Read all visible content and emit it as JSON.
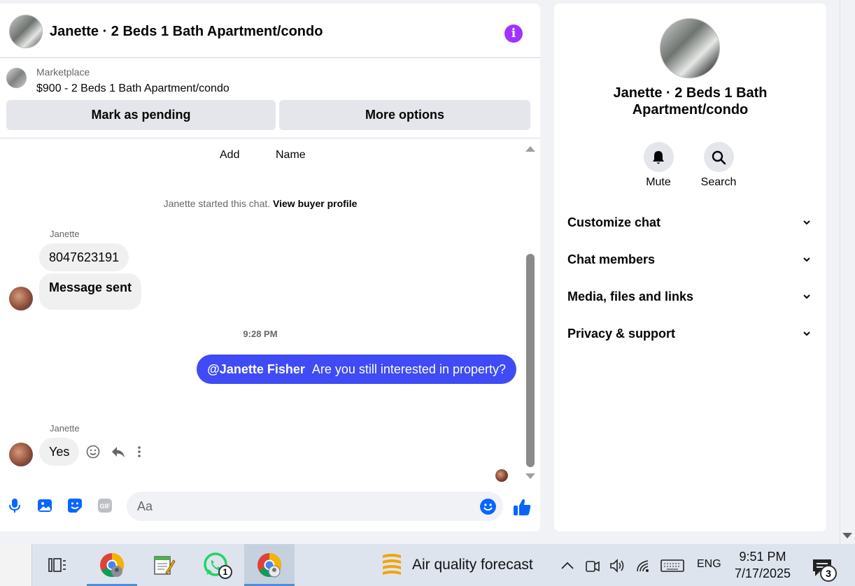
{
  "chat": {
    "title": "Janette · 2 Beds 1 Bath Apartment/condo",
    "marketplace_label": "Marketplace",
    "listing": "$900 - 2 Beds 1 Bath Apartment/condo",
    "mark_pending_label": "Mark as pending",
    "more_options_label": "More options",
    "add_label": "Add",
    "name_label": "Name",
    "started_text": "Janette started this chat.",
    "view_profile_label": "View buyer profile",
    "messages_in_1": {
      "sender": "Janette",
      "bubble1": "8047623191",
      "bubble2": "Message sent"
    },
    "time": "9:28 PM",
    "outgoing": {
      "mention": "@Janette Fisher",
      "text": "Are you still interested in property?"
    },
    "messages_in_2": {
      "sender": "Janette",
      "bubble": "Yes"
    },
    "composer_placeholder": "Aa",
    "accent": "#0866ff",
    "outgoing_bubble_color": "#3f4bf5"
  },
  "info": {
    "name": "Janette · 2 Beds 1 Bath Apartment/condo",
    "mute_label": "Mute",
    "search_label": "Search",
    "sections": [
      "Customize chat",
      "Chat members",
      "Media, files and links",
      "Privacy & support"
    ]
  },
  "taskbar": {
    "whatsapp_badge": "1",
    "weather_text": "Air quality forecast",
    "language": "ENG",
    "time": "9:51 PM",
    "date": "7/17/2025",
    "notification_count": "3"
  }
}
